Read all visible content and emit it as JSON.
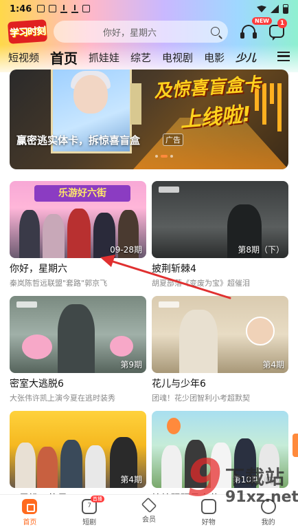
{
  "status_bar": {
    "time": "1:46"
  },
  "header": {
    "logo_text": "学习时刻",
    "search_placeholder": "你好，星期六",
    "new_badge": "NEW",
    "message_badge": "1"
  },
  "nav_tabs": [
    "短视频",
    "首页",
    "抓娃娃",
    "综艺",
    "电视剧",
    "电影",
    "少儿"
  ],
  "banner": {
    "headline1": "及惊喜盲盒卡",
    "headline2": "上线啦!",
    "caption": "赢密逃实体卡，拆惊喜盲盒",
    "ad_label": "广告"
  },
  "cards": [
    {
      "title": "你好，星期六",
      "subtitle": "秦岚陈哲远联盟\"套路\"郭京飞",
      "episode": "09-28期",
      "sign": "乐游好六街"
    },
    {
      "title": "披荆斩棘4",
      "subtitle": "胡夏部落《变废为宝》超催泪",
      "episode": "第8期（下）"
    },
    {
      "title": "密室大逃脱6",
      "subtitle": "大张伟许凯上演今夏在逃时装秀",
      "episode": "第9期"
    },
    {
      "title": "花儿与少年6",
      "subtitle": "团魂！花少团智利小考超默契",
      "episode": "第4期"
    },
    {
      "title": "五里挑一的是",
      "subtitle": "",
      "episode": "第4期"
    },
    {
      "title": "忙忙碌碌寻宝藏",
      "subtitle": "",
      "episode": "第10期（下）"
    }
  ],
  "bottom_nav": [
    {
      "label": "首页"
    },
    {
      "label": "短剧",
      "badge": "首播",
      "number": "7"
    },
    {
      "label": "会员"
    },
    {
      "label": "好物"
    },
    {
      "label": "我的"
    }
  ],
  "watermark": {
    "mark": "9",
    "text": "下载站",
    "url": "91xz.net"
  },
  "colors": {
    "accent": "#ff6a1e",
    "annotation_arrow": "#e03030",
    "ad_red": "#ff3b3b"
  }
}
